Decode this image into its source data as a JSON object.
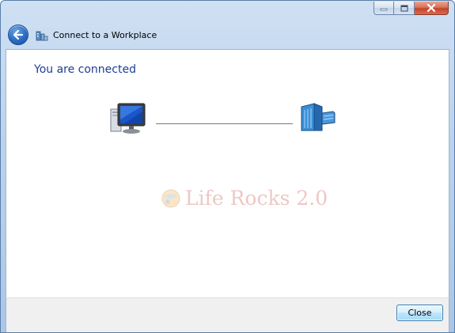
{
  "window": {
    "title": "Connect to a Workplace"
  },
  "nav": {
    "back_icon": "back-arrow-icon",
    "wizard_icon": "workplace-network-icon"
  },
  "main": {
    "heading": "You are connected",
    "left_icon": "computer-icon",
    "right_icon": "server-icon"
  },
  "watermark": {
    "text": "Life Rocks 2.0"
  },
  "footer": {
    "close_label": "Close"
  },
  "colors": {
    "heading": "#1e3d8f",
    "frame": "#bcd3ee",
    "close_caption": "#c2452a"
  }
}
